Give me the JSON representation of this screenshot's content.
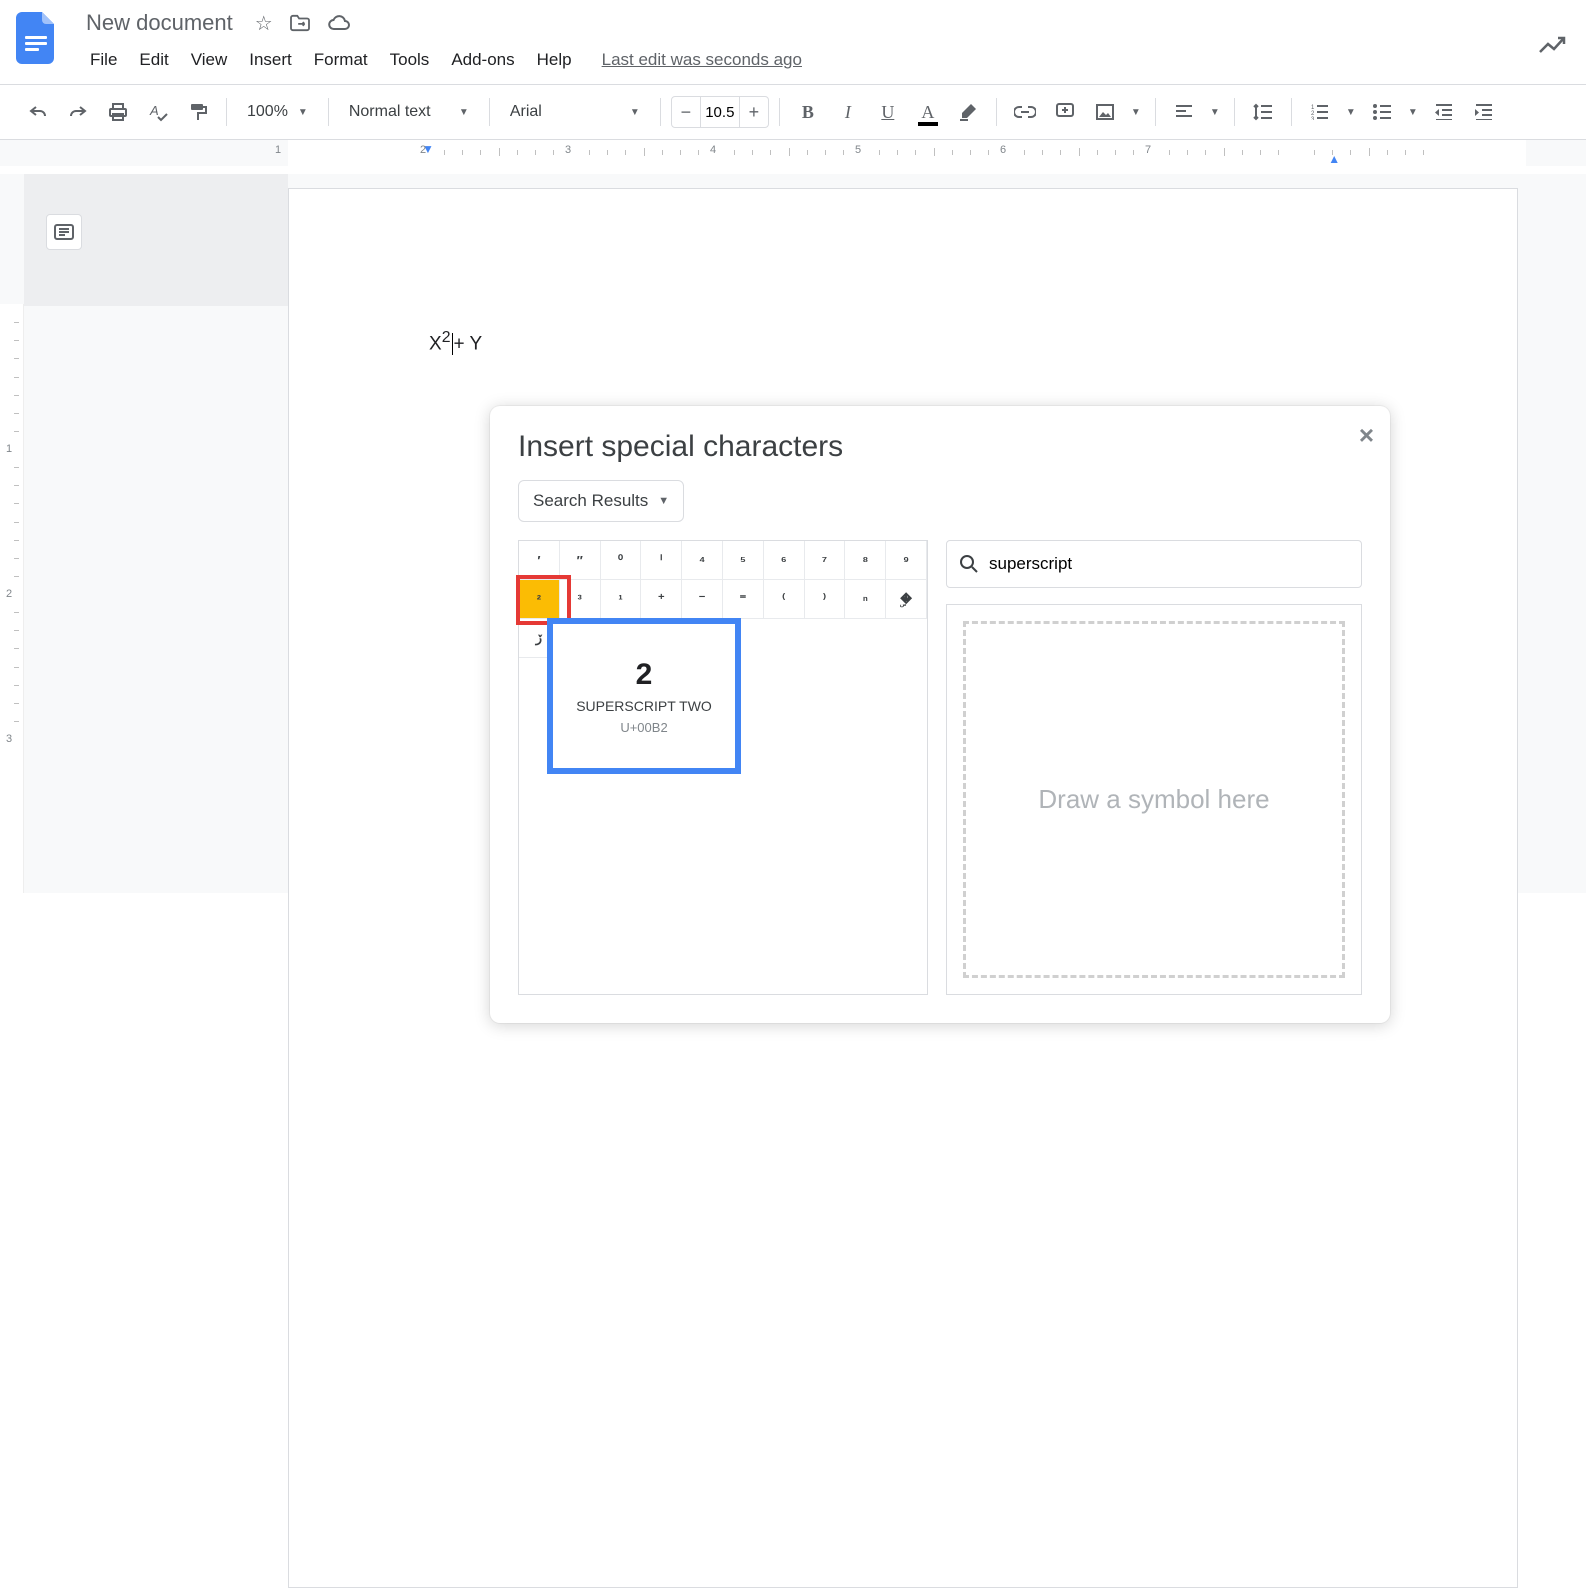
{
  "doc": {
    "title": "New document"
  },
  "menubar": [
    "File",
    "Edit",
    "View",
    "Insert",
    "Format",
    "Tools",
    "Add-ons",
    "Help"
  ],
  "last_edit": "Last edit was seconds ago",
  "toolbar": {
    "zoom": "100%",
    "style": "Normal text",
    "font": "Arial",
    "font_size": "10.5"
  },
  "ruler": {
    "numbers": [
      1,
      2,
      3,
      4,
      5,
      6,
      7
    ]
  },
  "document_text": {
    "pre": "X",
    "sup": "2",
    "post": "+ Y"
  },
  "dialog": {
    "title": "Insert special characters",
    "category": "Search Results",
    "search_value": "superscript",
    "draw_placeholder": "Draw a symbol here",
    "grid_row1": [
      "′",
      "″",
      "⁰",
      "ⁱ",
      "⁴",
      "⁵",
      "⁶",
      "⁷",
      "⁸",
      "⁹"
    ],
    "grid_row2": [
      "²",
      "³",
      "¹",
      "⁺",
      "⁻",
      "⁼",
      "⁽",
      "⁾",
      "ⁿ",
      "�ۣ"
    ],
    "grid_row3": [
      "ڒ"
    ],
    "selected_index": 10,
    "tooltip": {
      "glyph": "2",
      "name": "SUPERSCRIPT TWO",
      "code": "U+00B2"
    }
  }
}
